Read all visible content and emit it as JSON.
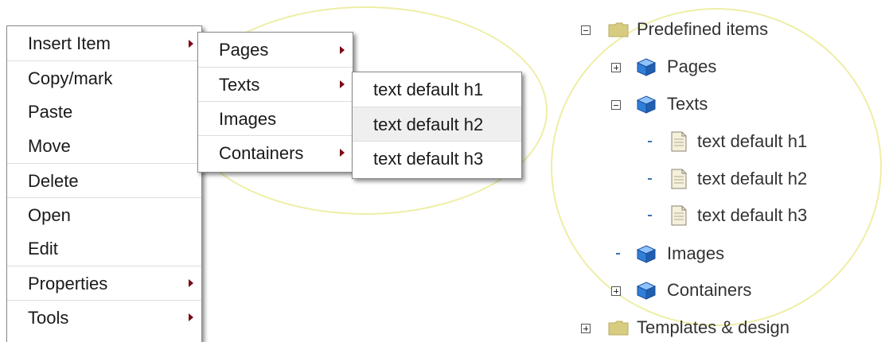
{
  "context_menu": {
    "items": [
      {
        "label": "Insert Item",
        "has_submenu": true
      },
      {
        "label": "Copy/mark",
        "has_submenu": false
      },
      {
        "label": "Paste",
        "has_submenu": false
      },
      {
        "label": "Move",
        "has_submenu": false
      },
      {
        "label": "Delete",
        "has_submenu": false
      },
      {
        "label": "Open",
        "has_submenu": false
      },
      {
        "label": "Edit",
        "has_submenu": false
      },
      {
        "label": "Properties",
        "has_submenu": true
      },
      {
        "label": "Tools",
        "has_submenu": true
      }
    ]
  },
  "insert_submenu": {
    "items": [
      {
        "label": "Pages",
        "has_submenu": true
      },
      {
        "label": "Texts",
        "has_submenu": true
      },
      {
        "label": "Images",
        "has_submenu": false
      },
      {
        "label": "Containers",
        "has_submenu": true
      }
    ]
  },
  "texts_submenu": {
    "items": [
      {
        "label": "text default h1"
      },
      {
        "label": "text default h2",
        "highlighted": true
      },
      {
        "label": "text default h3"
      }
    ]
  },
  "tree": {
    "nodes": [
      {
        "label": "Predefined items",
        "icon": "folder-icon",
        "expander": "minus"
      },
      {
        "label": "Pages",
        "icon": "cube-icon",
        "expander": "plus"
      },
      {
        "label": "Texts",
        "icon": "cube-icon",
        "expander": "minus"
      },
      {
        "label": "text default h1",
        "icon": "document-icon",
        "expander": "dot"
      },
      {
        "label": "text default h2",
        "icon": "document-icon",
        "expander": "dot"
      },
      {
        "label": "text default h3",
        "icon": "document-icon",
        "expander": "dot"
      },
      {
        "label": "Images",
        "icon": "cube-icon",
        "expander": "dot"
      },
      {
        "label": "Containers",
        "icon": "cube-icon",
        "expander": "plus"
      },
      {
        "label": "Templates & design",
        "icon": "folder-icon",
        "expander": "plus"
      }
    ]
  },
  "colors": {
    "menu_border": "#8a8a8a",
    "submenu_arrow": "#7a0a14",
    "highlight_ring": "#eeeea6",
    "hover_background": "#efefef",
    "folder": "#d8cc80",
    "cube": "#2f7fd8"
  }
}
